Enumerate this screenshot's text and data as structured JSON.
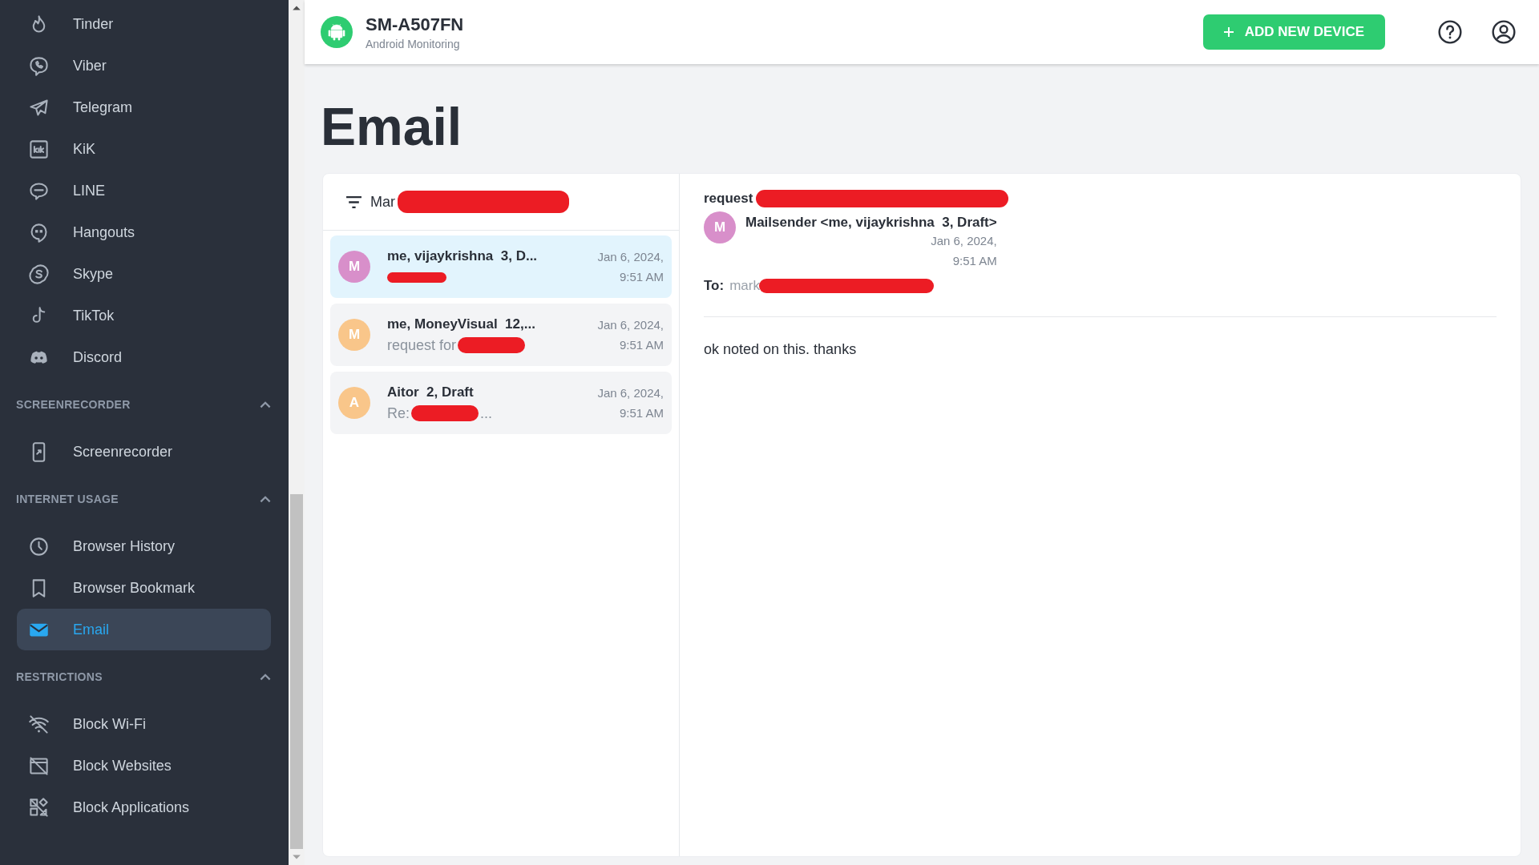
{
  "header": {
    "device_name": "SM-A507FN",
    "device_subtitle": "Android Monitoring",
    "add_button": "ADD NEW DEVICE"
  },
  "sidebar": {
    "sections": [
      {
        "items": [
          {
            "label": "Tinder",
            "selected": false
          },
          {
            "label": "Viber",
            "selected": false
          },
          {
            "label": "Telegram",
            "selected": false
          },
          {
            "label": "KiK",
            "selected": false
          },
          {
            "label": "LINE",
            "selected": false
          },
          {
            "label": "Hangouts",
            "selected": false
          },
          {
            "label": "Skype",
            "selected": false
          },
          {
            "label": "TikTok",
            "selected": false
          },
          {
            "label": "Discord",
            "selected": false
          }
        ]
      },
      {
        "title": "SCREENRECORDER",
        "expanded": true,
        "items": [
          {
            "label": "Screenrecorder",
            "selected": false
          }
        ]
      },
      {
        "title": "INTERNET USAGE",
        "expanded": true,
        "items": [
          {
            "label": "Browser History",
            "selected": false
          },
          {
            "label": "Browser Bookmark",
            "selected": false
          },
          {
            "label": "Email",
            "selected": true
          }
        ]
      },
      {
        "title": "RESTRICTIONS",
        "expanded": true,
        "items": [
          {
            "label": "Block Wi-Fi",
            "selected": false
          },
          {
            "label": "Block Websites",
            "selected": false
          },
          {
            "label": "Block Applications",
            "selected": false
          }
        ]
      }
    ]
  },
  "page_title": "Email",
  "email_list": {
    "filter": {
      "text": "Mar",
      "redacted": true
    },
    "items": [
      {
        "avatar": "M",
        "color": "#d88fca",
        "sender": "me, vijaykrishna  3, D...",
        "preview_redacted": true,
        "date": "Jan 6, 2024,",
        "time": "9:51 AM",
        "selected": true
      },
      {
        "avatar": "M",
        "color": "#f9c68a",
        "sender": "me, MoneyVisual  12,...",
        "preview": "request for",
        "preview_redacted": true,
        "date": "Jan 6, 2024,",
        "time": "9:51 AM",
        "selected": false
      },
      {
        "avatar": "A",
        "color": "#f9c68a",
        "sender": "Aitor  2, Draft",
        "preview": "Re:",
        "preview_redacted": true,
        "preview_end": "...",
        "date": "Jan 6, 2024,",
        "time": "9:51 AM",
        "selected": false
      }
    ]
  },
  "message": {
    "subject": "request",
    "subject_redacted": true,
    "avatar": "M",
    "sender": "Mailsender <me, vijaykrishna  3, Draft>",
    "date": "Jan 6, 2024,",
    "time": "9:51 AM",
    "to_label": "To:",
    "to": "mark",
    "to_redacted": true,
    "body": "ok noted on this. thanks"
  }
}
